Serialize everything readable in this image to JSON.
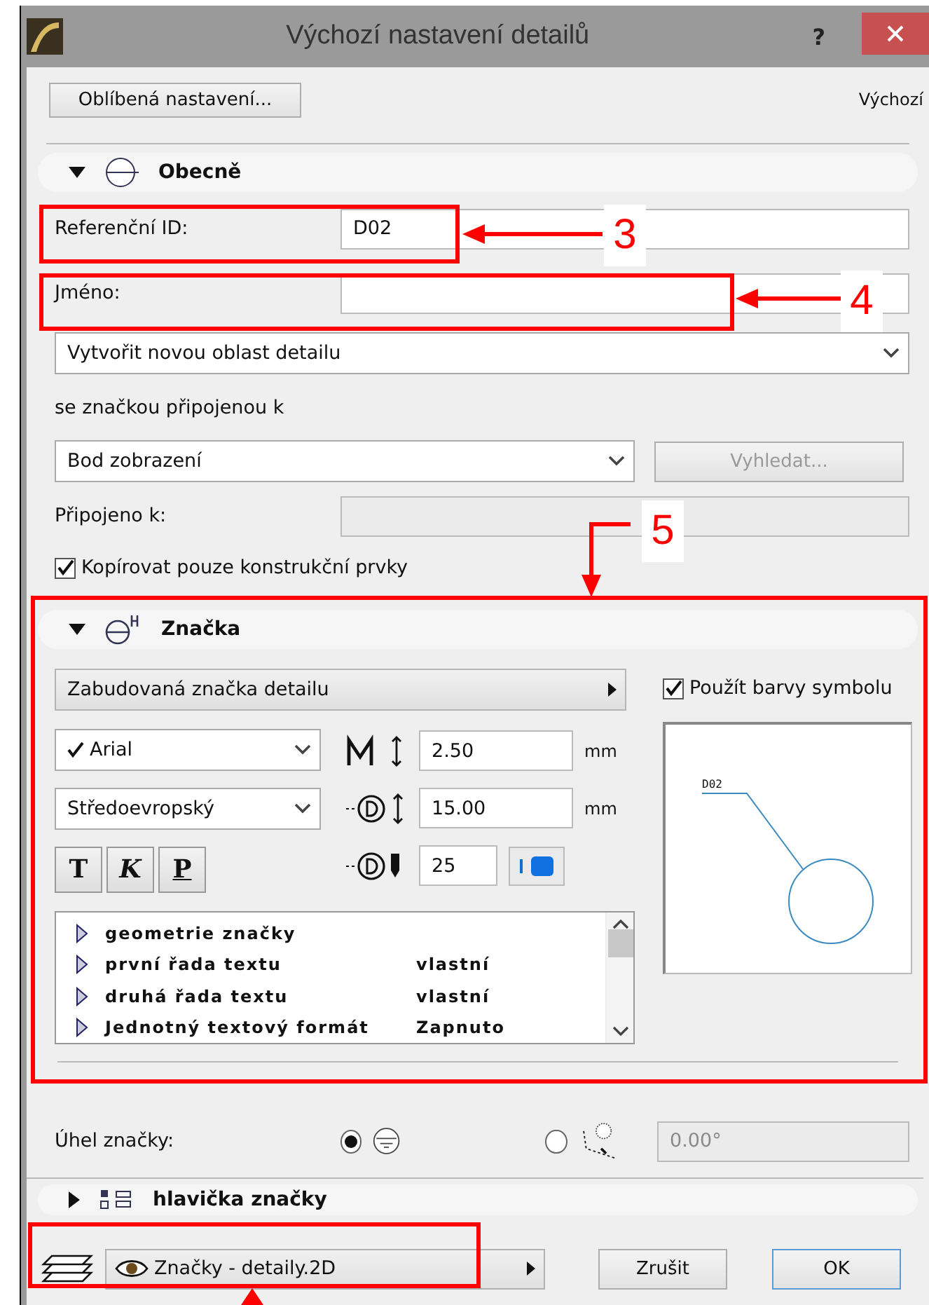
{
  "window": {
    "title": "Výchozí nastavení detailů",
    "help": "?"
  },
  "toolbar": {
    "favorites_button": "Oblíbená nastavení...",
    "preset_label": "Výchozí"
  },
  "general": {
    "title": "Obecně",
    "expanded": true,
    "reference_id": {
      "label": "Referenční ID:",
      "value": "D02"
    },
    "name": {
      "label": "Jméno:"
    },
    "area_select": "Vytvořit novou oblast detailu",
    "marker_link_label": "se značkou připojenou k",
    "marker_link_select": "Bod zobrazení",
    "find_button": {
      "label": "Vyhledat...",
      "disabled": true
    },
    "linked_to": {
      "label": "Připojeno k:",
      "disabled": true
    },
    "copy_construction_only": {
      "label": "Kopírovat pouze konstrukční prvky",
      "checked": true
    }
  },
  "marker": {
    "title": "Značka",
    "expanded": true,
    "marker_type": "Zabudovaná značka detailu",
    "use_symbol_colors": {
      "label": "Použít barvy symbolu",
      "checked": true
    },
    "font": {
      "value": "Arial",
      "checked": true
    },
    "encoding": "Středoevropský",
    "text_height": {
      "value": "2.50",
      "unit": "mm"
    },
    "marker_size": {
      "value": "15.00",
      "unit": "mm"
    },
    "pen": "25",
    "style_buttons": [
      {
        "label": "T",
        "kind": "bold"
      },
      {
        "label": "K",
        "kind": "italic"
      },
      {
        "label": "P",
        "kind": "underline"
      }
    ],
    "preview_label": "D02",
    "parameters": [
      {
        "name": "geometrie značky"
      },
      {
        "name": "první řada textu",
        "value": "vlastní"
      },
      {
        "name": "druhá řada textu",
        "value": "vlastní"
      },
      {
        "name": "Jednotný textový formát",
        "value": "Zapnuto"
      }
    ]
  },
  "angle": {
    "label": "Úhel značky:",
    "options": [
      {
        "selected": true
      },
      {
        "selected": false
      }
    ],
    "value": "0.00°",
    "disabled": true
  },
  "header_section": {
    "title": "hlavička značky",
    "expanded": false
  },
  "footer": {
    "layer": "Značky - detaily.2D",
    "cancel": "Zrušit",
    "ok": "OK"
  },
  "annotations": [
    {
      "label": "3"
    },
    {
      "label": "4"
    },
    {
      "label": "5"
    }
  ]
}
